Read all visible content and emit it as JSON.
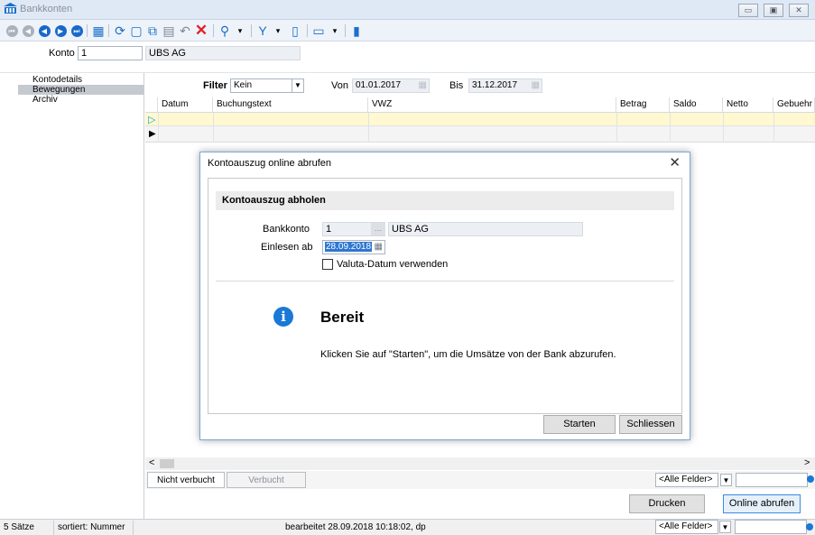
{
  "window": {
    "title": "Bankkonten"
  },
  "konto": {
    "label": "Konto",
    "value": "1",
    "name": "UBS AG"
  },
  "sidebar": {
    "items": [
      {
        "label": "Kontodetails"
      },
      {
        "label": "Bewegungen"
      },
      {
        "label": "Archiv"
      }
    ]
  },
  "filter": {
    "label": "Filter",
    "value": "Kein",
    "von_label": "Von",
    "von_value": "01.01.2017",
    "bis_label": "Bis",
    "bis_value": "31.12.2017"
  },
  "grid": {
    "columns": [
      "Datum",
      "Buchungstext",
      "VWZ",
      "Betrag",
      "Saldo",
      "Netto",
      "Gebuehr"
    ]
  },
  "dialog": {
    "title": "Kontoauszug online abrufen",
    "section": "Kontoauszug abholen",
    "bankkonto_label": "Bankkonto",
    "bankkonto_value": "1",
    "bankkonto_name": "UBS AG",
    "einlesen_label": "Einlesen ab",
    "einlesen_value": "28.09.2018",
    "valuta_label": "Valuta-Datum verwenden",
    "status_title": "Bereit",
    "status_text": "Klicken Sie auf \"Starten\", um die Umsätze von der Bank abzurufen.",
    "start_button": "Starten",
    "close_button": "Schliessen"
  },
  "bottom": {
    "tab_unbooked": "Nicht verbucht",
    "tab_booked": "Verbucht",
    "filter_combo": "<Alle Felder>",
    "print_button": "Drucken",
    "online_button": "Online abrufen"
  },
  "status": {
    "records": "5 Sätze",
    "sort": "sortiert: Nummer",
    "edited": "bearbeitet 28.09.2018 10:18:02, dp",
    "combo": "<Alle Felder>"
  }
}
